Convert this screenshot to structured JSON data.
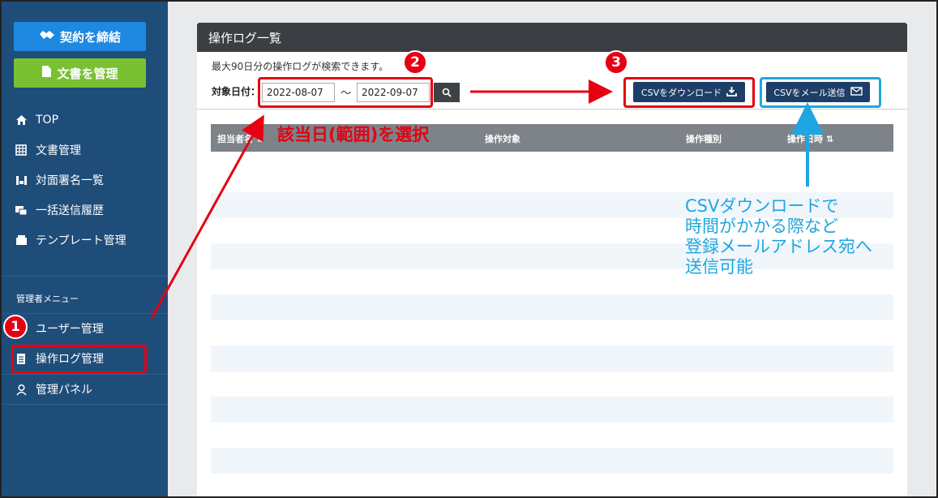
{
  "sidebar": {
    "contract_button": "契約を締結",
    "docs_button": "文書を管理",
    "items": [
      {
        "label": "TOP",
        "icon": "home-icon"
      },
      {
        "label": "文書管理",
        "icon": "grid-icon"
      },
      {
        "label": "対面署名一覧",
        "icon": "sign-icon"
      },
      {
        "label": "一括送信履歴",
        "icon": "bulk-send-icon"
      },
      {
        "label": "テンプレート管理",
        "icon": "template-icon"
      }
    ],
    "admin_section": "管理者メニュー",
    "admin_items": [
      {
        "label": "ユーザー管理",
        "icon": "users-icon"
      },
      {
        "label": "操作ログ管理",
        "icon": "log-icon"
      },
      {
        "label": "管理パネル",
        "icon": "person-icon"
      }
    ]
  },
  "panel": {
    "title": "操作ログ一覧",
    "hint": "最大90日分の操作ログが検索できます。",
    "date_label": "対象日付：",
    "date_from": "2022-08-07",
    "tilde": "〜",
    "date_to": "2022-09-07",
    "csv_download": "CSVをダウンロード",
    "csv_mail": "CSVをメール送信",
    "columns": [
      "担当者名",
      "操作対象",
      "操作種別",
      "操作日時"
    ],
    "sort_glyph": "⇅"
  },
  "annotations": {
    "badge_1": "1",
    "badge_2": "2",
    "badge_3": "3",
    "red_text": "該当日(範囲)を選択",
    "blue_text": [
      "CSVダウンロードで",
      "時間がかかる際など",
      "登録メールアドレス宛へ",
      "送信可能"
    ]
  },
  "colors": {
    "sidebar_bg": "#1f4d7a",
    "contract_blue": "#1f88e0",
    "docs_green": "#7ac132",
    "annotation_red": "#e60012",
    "annotation_blue": "#1ea6e0"
  }
}
